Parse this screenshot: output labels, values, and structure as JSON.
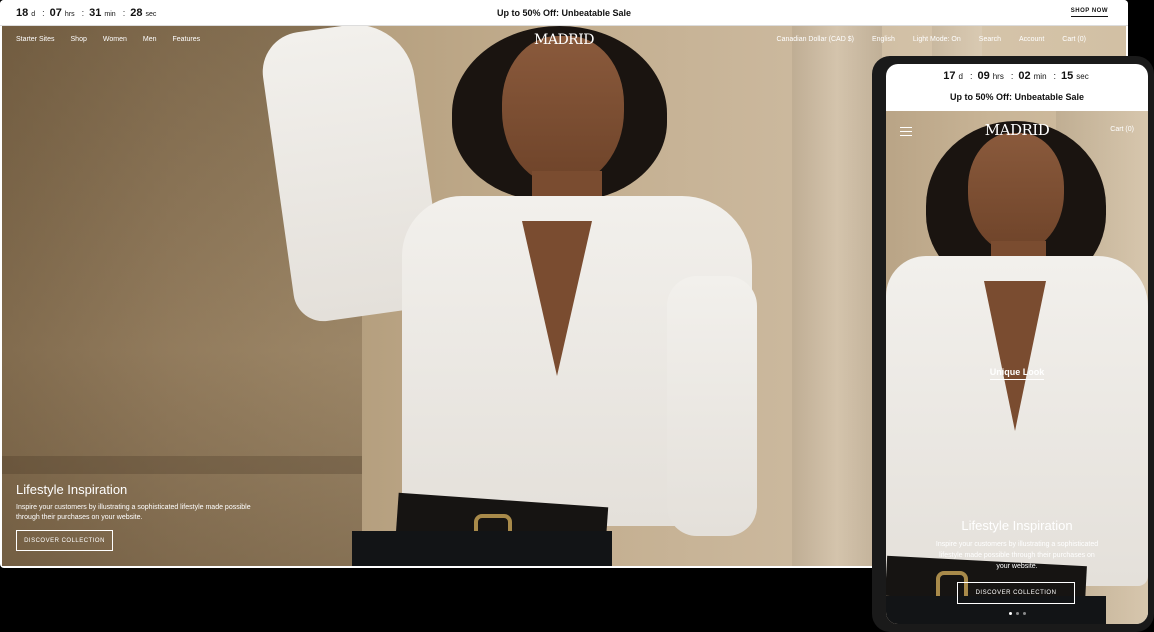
{
  "desktop": {
    "countdown": {
      "days": "18",
      "days_unit": "d",
      "hours": "07",
      "hours_unit": "hrs",
      "minutes": "31",
      "minutes_unit": "min",
      "seconds": "28",
      "seconds_unit": "sec"
    },
    "promo": "Up to 50% Off: Unbeatable Sale",
    "shop_now": "SHOP NOW",
    "nav_left": [
      "Starter Sites",
      "Shop",
      "Women",
      "Men",
      "Features"
    ],
    "logo": "MADRID",
    "nav_right": [
      "Canadian Dollar (CAD $)",
      "English",
      "Light Mode: On",
      "Search",
      "Account",
      "Cart (0)"
    ],
    "hero": {
      "title": "Lifestyle Inspiration",
      "description": "Inspire your customers by illustrating a sophisticated lifestyle made possible through their purchases on your website.",
      "cta": "DISCOVER COLLECTION"
    }
  },
  "mobile": {
    "countdown": {
      "days": "17",
      "days_unit": "d",
      "hours": "09",
      "hours_unit": "hrs",
      "minutes": "02",
      "minutes_unit": "min",
      "seconds": "15",
      "seconds_unit": "sec"
    },
    "promo": "Up to 50% Off: Unbeatable Sale",
    "logo": "MADRID",
    "cart": "Cart (0)",
    "hotspot_label": "Unique Look",
    "hero": {
      "title": "Lifestyle Inspiration",
      "description": "Inspire your customers by illustrating a sophisticated lifestyle made possible through their purchases on your website.",
      "cta": "DISCOVER COLLECTION"
    },
    "slide_count": 3,
    "active_slide": 1
  }
}
